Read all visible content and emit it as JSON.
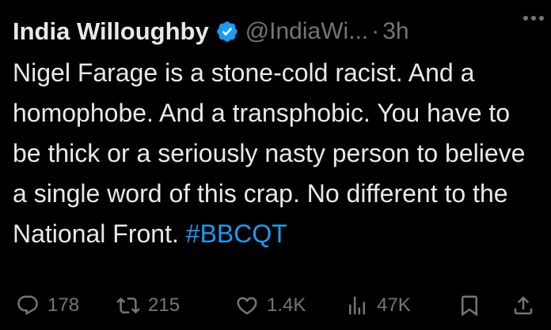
{
  "tweet": {
    "author": {
      "display_name": "India Willoughby",
      "handle": "@IndiaWi...",
      "verified_icon": "verified-badge-icon",
      "badge_color": "#1d9bf0"
    },
    "separator": "·",
    "time": "3h",
    "more_icon": "more-options-icon",
    "body": {
      "text": "Nigel Farage is a stone-cold racist. And a homophobe. And a transphobic. You have to be thick or a seriously nasty person to believe a single word of this crap. No different to the National Front. ",
      "hashtag": "#BBCQT",
      "hashtag_color": "#1d9bf0"
    },
    "actions": {
      "reply": {
        "icon": "reply-icon",
        "count": "178"
      },
      "retweet": {
        "icon": "retweet-icon",
        "count": "215"
      },
      "like": {
        "icon": "like-icon",
        "count": "1.4K"
      },
      "views": {
        "icon": "views-icon",
        "count": "47K"
      },
      "bookmark": {
        "icon": "bookmark-icon"
      },
      "share": {
        "icon": "share-icon"
      }
    }
  }
}
